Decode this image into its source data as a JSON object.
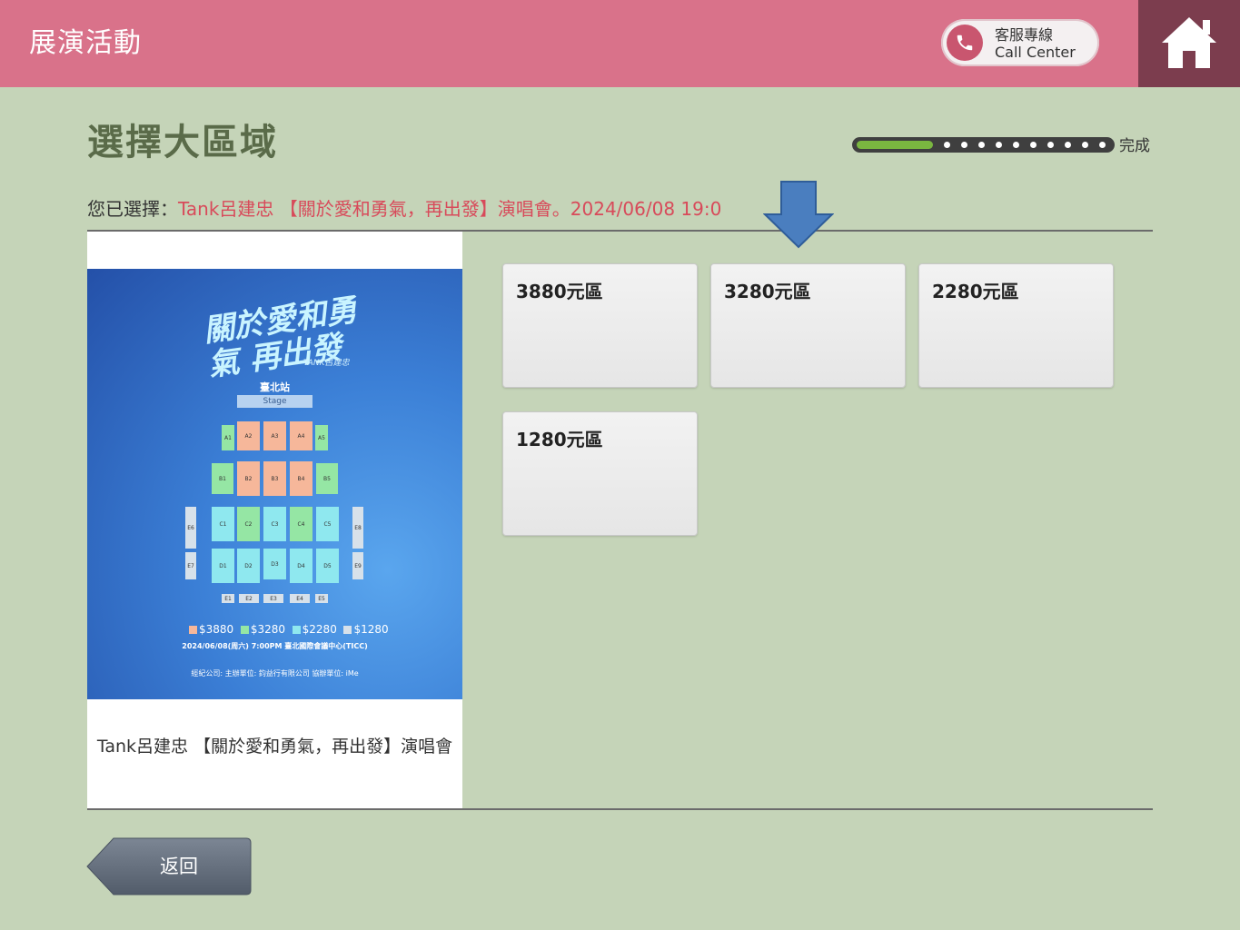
{
  "header": {
    "title": "展演活動",
    "call_center": {
      "label_zh": "客服專線",
      "label_en": "Call Center",
      "icon": "phone-icon"
    },
    "home_icon": "home-icon"
  },
  "page": {
    "title": "選擇大區域",
    "progress": {
      "label": "完成",
      "fraction": 0.3,
      "steps": 10
    }
  },
  "selection": {
    "label": "您已選擇：",
    "value": "Tank呂建忠 【關於愛和勇氣，再出發】演唱會。2024/06/08 19:0"
  },
  "event": {
    "name": "Tank呂建忠 【關於愛和勇氣，再出發】演唱會",
    "poster": {
      "title": "關於愛和勇氣 再出發",
      "subtitle": "TANK呂建忠",
      "city": "臺北站",
      "stage": "Stage",
      "legend": [
        "$3880",
        "$3280",
        "$2280",
        "$1280"
      ],
      "date_line": "2024/06/08(周六) 7:00PM    臺北國際會議中心(TICC)",
      "footer": "經紀公司:         主辦單位: 鈞益行有限公司      協辦單位: iMe"
    }
  },
  "zones": [
    {
      "label": "3880元區"
    },
    {
      "label": "3280元區"
    },
    {
      "label": "2280元區"
    },
    {
      "label": "1280元區"
    }
  ],
  "back_button": {
    "label": "返回"
  },
  "colors": {
    "header": "#d9728a",
    "home": "#7c3d4e",
    "background": "#c5d4b8",
    "selection_value": "#d84a5a",
    "arrow": "#4a7ebf",
    "progress_fill": "#7ab640"
  }
}
